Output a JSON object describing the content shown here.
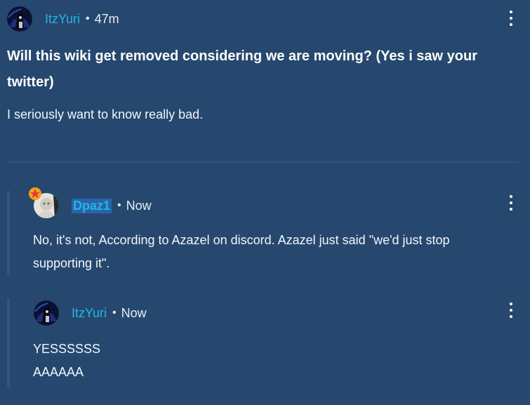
{
  "post": {
    "author": "ItzYuri",
    "separator": "•",
    "time": "47m",
    "title": "Will this wiki get removed considering we are moving? (Yes i saw your twitter)",
    "body": "I seriously want to know really bad."
  },
  "replies": [
    {
      "author": "Dpaz1",
      "separator": "•",
      "time": "Now",
      "lines": [
        "No, it's not, According to Azazel on discord. Azazel just said \"we'd just stop",
        "supporting it\"."
      ]
    },
    {
      "author": "ItzYuri",
      "separator": "•",
      "time": "Now",
      "lines": [
        "YESSSSSS",
        "AAAAAA"
      ]
    }
  ],
  "icons": {
    "more": "kebab-menu-icon",
    "badge": "star-badge-icon"
  },
  "colors": {
    "background": "#26486e",
    "username": "#1fb7e5",
    "username_highlight_bg": "#2b63a9",
    "divider": "#2f5680",
    "badge": "#f4a21b"
  }
}
